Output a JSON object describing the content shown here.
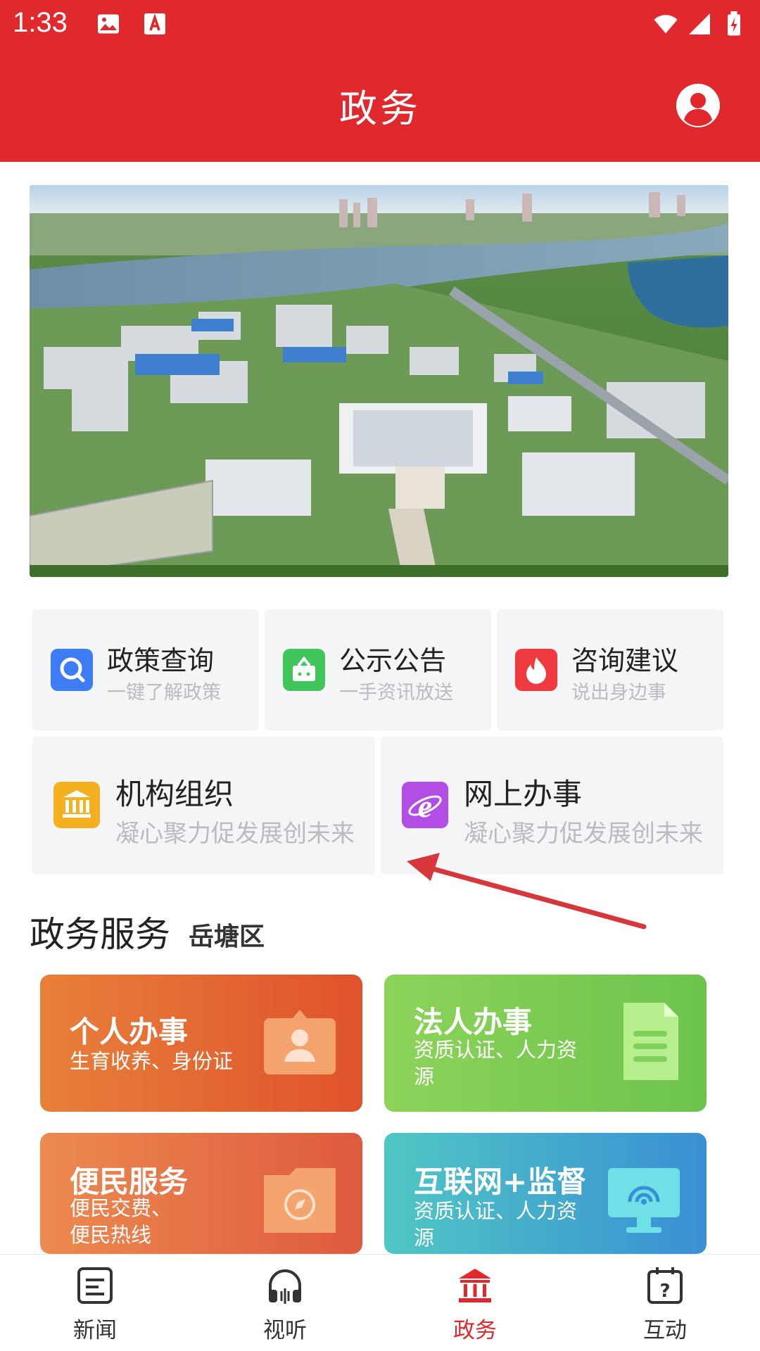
{
  "status_bar": {
    "time": "1:33"
  },
  "header": {
    "title": "政务"
  },
  "quick_links": [
    {
      "title": "政策查询",
      "subtitle": "一键了解政策",
      "icon": "search-icon"
    },
    {
      "title": "公示公告",
      "subtitle": "一手资讯放送",
      "icon": "bag-icon"
    },
    {
      "title": "咨询建议",
      "subtitle": "说出身边事",
      "icon": "flame-icon"
    },
    {
      "title": "机构组织",
      "subtitle": "凝心聚力促发展创未来",
      "icon": "institution-icon"
    },
    {
      "title": "网上办事",
      "subtitle": "凝心聚力促发展创未来",
      "icon": "ie-icon"
    }
  ],
  "section": {
    "title": "政务服务",
    "district": "岳塘区"
  },
  "services": [
    {
      "title": "个人办事",
      "desc": "生育收养、身份证",
      "icon": "id-card-icon"
    },
    {
      "title": "法人办事",
      "desc": "资质认证、人力资源",
      "icon": "document-icon"
    },
    {
      "title": "便民服务",
      "desc": "便民交费、便民热线",
      "icon": "folder-compass-icon"
    },
    {
      "title": "互联网+监督",
      "desc": "资质认证、人力资源",
      "icon": "monitor-icon"
    }
  ],
  "bottom_nav": [
    {
      "label": "新闻",
      "icon": "news-icon"
    },
    {
      "label": "视听",
      "icon": "headphones-icon"
    },
    {
      "label": "政务",
      "icon": "government-icon",
      "active": true
    },
    {
      "label": "互动",
      "icon": "calendar-question-icon"
    }
  ],
  "colors": {
    "brand_red": "#e1282d",
    "card_bg": "#f4f5f7",
    "subtitle_gray": "#b9bcc2"
  }
}
